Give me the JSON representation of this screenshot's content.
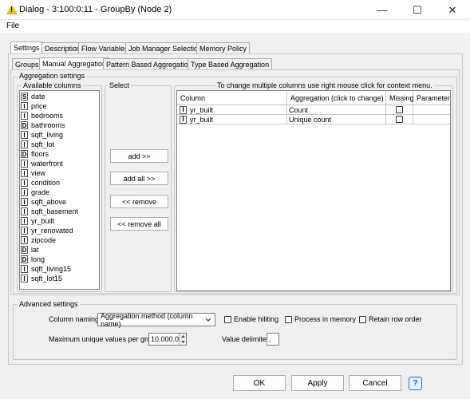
{
  "window": {
    "title": "Dialog - 3:100:0:11 - GroupBy (Node 2)",
    "minimize_glyph": "—",
    "maximize_glyph": "☐",
    "close_glyph": "✕"
  },
  "menu": {
    "file": "File"
  },
  "outer_tabs": [
    {
      "label": "Settings"
    },
    {
      "label": "Description"
    },
    {
      "label": "Flow Variables"
    },
    {
      "label": "Job Manager Selection"
    },
    {
      "label": "Memory Policy"
    }
  ],
  "inner_tabs": [
    {
      "label": "Groups"
    },
    {
      "label": "Manual Aggregation"
    },
    {
      "label": "Pattern Based Aggregation"
    },
    {
      "label": "Type Based Aggregation"
    }
  ],
  "aggregation": {
    "group_title": "Aggregation settings",
    "available_title": "Available columns",
    "select_title": "Select",
    "hint": "To change multiple columns use right mouse click for context menu.",
    "columns": [
      {
        "type": "S",
        "name": "date"
      },
      {
        "type": "I",
        "name": "price"
      },
      {
        "type": "I",
        "name": "bedrooms"
      },
      {
        "type": "D",
        "name": "bathrooms"
      },
      {
        "type": "I",
        "name": "sqft_living"
      },
      {
        "type": "I",
        "name": "sqft_lot"
      },
      {
        "type": "D",
        "name": "floors"
      },
      {
        "type": "I",
        "name": "waterfront"
      },
      {
        "type": "I",
        "name": "view"
      },
      {
        "type": "I",
        "name": "condition"
      },
      {
        "type": "I",
        "name": "grade"
      },
      {
        "type": "I",
        "name": "sqft_above"
      },
      {
        "type": "I",
        "name": "sqft_basement"
      },
      {
        "type": "I",
        "name": "yr_built"
      },
      {
        "type": "I",
        "name": "yr_renovated"
      },
      {
        "type": "I",
        "name": "zipcode"
      },
      {
        "type": "D",
        "name": "lat"
      },
      {
        "type": "D",
        "name": "long"
      },
      {
        "type": "I",
        "name": "sqft_living15"
      },
      {
        "type": "I",
        "name": "sqft_lot15"
      }
    ],
    "buttons": {
      "add": "add >>",
      "add_all": "add all >>",
      "remove": "<< remove",
      "remove_all": "<< remove all"
    },
    "table": {
      "headers": {
        "column": "Column",
        "aggregation": "Aggregation (click to change)",
        "missing": "Missing",
        "parameter": "Parameter"
      },
      "rows": [
        {
          "type": "I",
          "column": "yr_built",
          "aggregation": "Count",
          "missing": false,
          "parameter": ""
        },
        {
          "type": "I",
          "column": "yr_built",
          "aggregation": "Unique count",
          "missing": false,
          "parameter": ""
        }
      ]
    }
  },
  "advanced": {
    "title": "Advanced settings",
    "column_naming_label": "Column naming:",
    "column_naming_value": "Aggregation method (column name)",
    "enable_hiliting": "Enable hiliting",
    "process_in_memory": "Process in memory",
    "retain_row_order": "Retain row order",
    "max_unique_label": "Maximum unique values per group",
    "max_unique_value": "10.000.0",
    "value_delimiter_label": "Value delimiter",
    "value_delimiter_value": ","
  },
  "footer": {
    "ok": "OK",
    "apply": "Apply",
    "cancel": "Cancel",
    "help_glyph": "?"
  }
}
